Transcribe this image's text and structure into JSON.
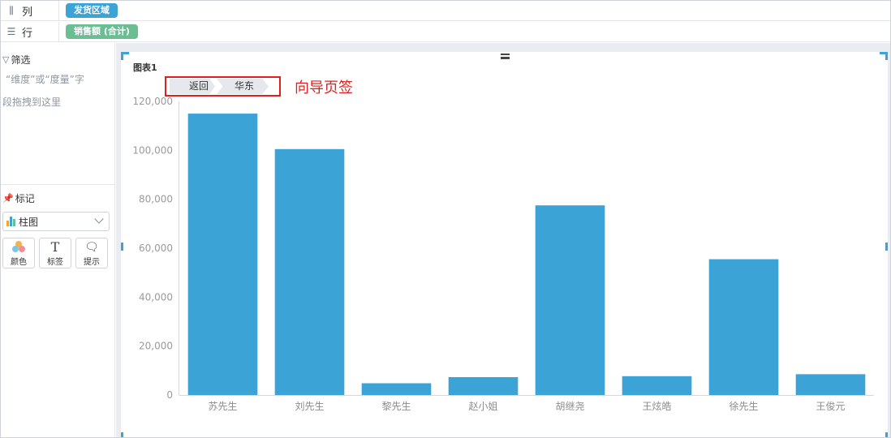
{
  "shelves": {
    "columns": {
      "icon": "columns-icon",
      "label": "列",
      "pill": "发货区域"
    },
    "rows": {
      "icon": "rows-icon",
      "label": "行",
      "pill": "销售额 (合计)"
    }
  },
  "filter": {
    "title": "筛选",
    "hint_line1": "“维度”或“度量”字",
    "hint_line2": "段拖拽到这里"
  },
  "marks": {
    "title": "标记",
    "chart_type": "柱图",
    "buttons": [
      {
        "icon": "color-icon",
        "label": "颜色"
      },
      {
        "icon": "text-label-icon",
        "label": "标签"
      },
      {
        "icon": "tooltip-icon",
        "label": "提示"
      }
    ]
  },
  "chart": {
    "title": "图表1",
    "breadcrumb": {
      "back": "返回",
      "current": "华东"
    },
    "annotation": "向导页签"
  },
  "colors": {
    "bar": "#3ba3d6",
    "accent_red": "#e02020",
    "pill_blue": "#3ba3d6",
    "pill_green": "#6bbd93"
  },
  "chart_data": {
    "type": "bar",
    "categories": [
      "苏先生",
      "刘先生",
      "黎先生",
      "赵小姐",
      "胡继尧",
      "王炫皓",
      "徐先生",
      "王俊元"
    ],
    "values": [
      115000,
      100500,
      4800,
      7300,
      77500,
      7700,
      55500,
      8500
    ],
    "ylim": [
      0,
      120000
    ],
    "yticks": [
      "0",
      "20,000",
      "40,000",
      "60,000",
      "80,000",
      "100,000",
      "120,000"
    ],
    "grid": false
  }
}
